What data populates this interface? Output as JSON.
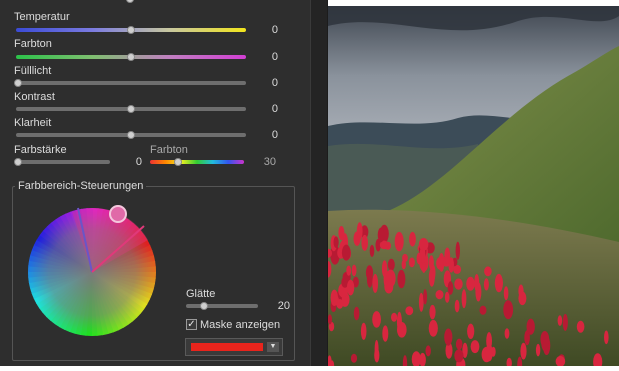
{
  "panel": {
    "sliders": [
      {
        "label": "Temperatur",
        "value": "0",
        "level": 0.5
      },
      {
        "label": "Farbton",
        "value": "0",
        "level": 0.5
      },
      {
        "label": "Fülllicht",
        "value": "0",
        "level": 0.0
      },
      {
        "label": "Kontrast",
        "value": "0",
        "level": 0.5
      },
      {
        "label": "Klarheit",
        "value": "0",
        "level": 0.5
      }
    ],
    "saturation": {
      "label": "Farbstärke",
      "value": "0",
      "level": 0.0
    },
    "hue": {
      "label": "Farbton",
      "value": "30",
      "level": 0.2
    }
  },
  "color_range": {
    "title": "Farbbereich-Steuerungen",
    "smoothness_label": "Glätte",
    "smoothness_value": "20",
    "smoothness_level": 0.2,
    "mask_label": "Maske anzeigen",
    "mask_checked": true,
    "mask_check_glyph": "✓",
    "mask_color": "#e8241c",
    "dropdown_arrow": "▼"
  },
  "icons": {
    "color_wheel": "hue-wheel-icon",
    "photo": "mountain-valley-photo"
  },
  "colors": {
    "panel_bg": "#2e2e2e",
    "accent_selection": "#e0397a"
  }
}
